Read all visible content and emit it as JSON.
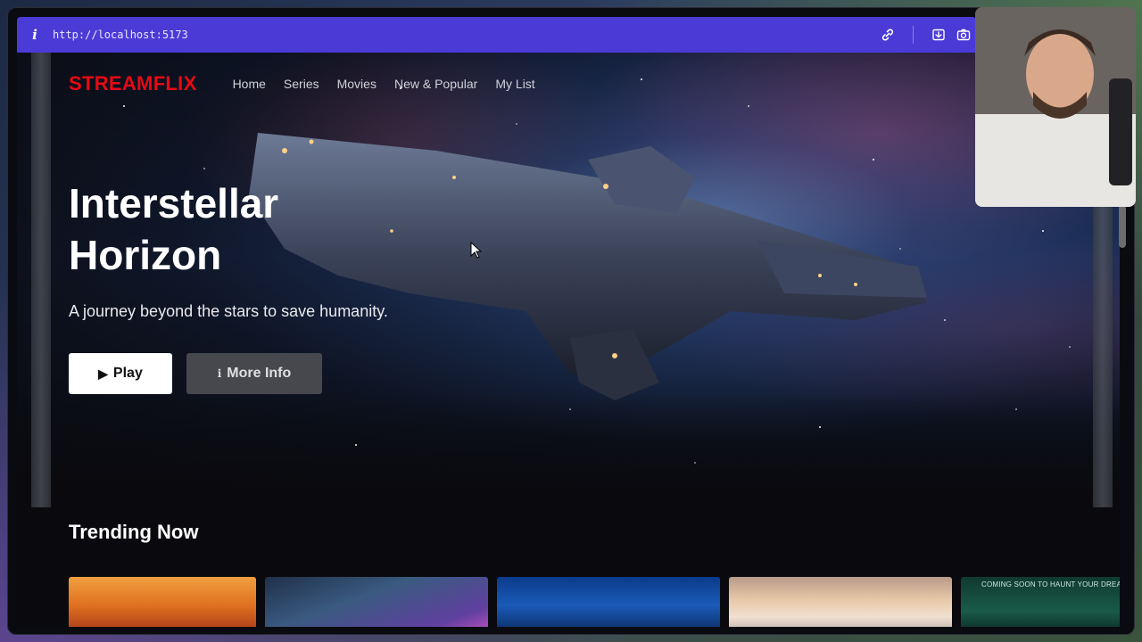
{
  "browser": {
    "url": "http://localhost:5173",
    "info_icon": "info-icon",
    "action_icons": [
      "link-icon",
      "screenshot-area-icon",
      "camera-icon"
    ]
  },
  "app": {
    "logo": "STREAMFLIX",
    "brand_color": "#e50914",
    "nav": [
      {
        "label": "Home"
      },
      {
        "label": "Series"
      },
      {
        "label": "Movies"
      },
      {
        "label": "New & Popular"
      },
      {
        "label": "My List"
      }
    ],
    "hero": {
      "title": "Interstellar Horizon",
      "subtitle": "A journey beyond the stars to save humanity.",
      "play_label": "Play",
      "info_label": "More Info"
    },
    "trending": {
      "heading": "Trending Now",
      "cards": [
        {
          "theme": "samurai-sunset"
        },
        {
          "theme": "neon-city"
        },
        {
          "theme": "underwater-jellyfish"
        },
        {
          "theme": "clouds-sunrise"
        },
        {
          "theme": "haunted-forest",
          "caption": "COMING SOON TO HAUNT YOUR DREA"
        }
      ]
    }
  }
}
